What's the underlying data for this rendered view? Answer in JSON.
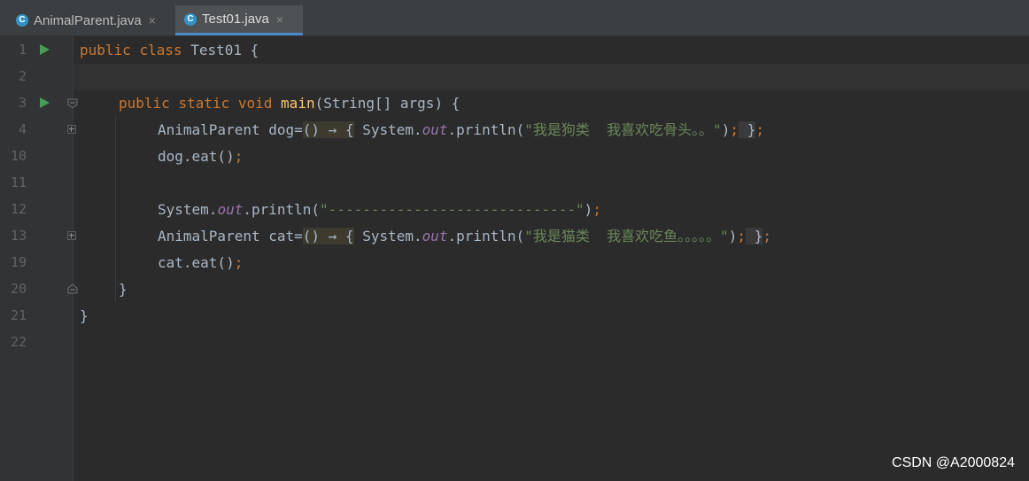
{
  "tabs": [
    {
      "label": "AnimalParent.java",
      "icon": "java-class-icon",
      "active": false,
      "close": "×"
    },
    {
      "label": "Test01.java",
      "icon": "java-class-icon",
      "active": true,
      "close": "×"
    }
  ],
  "gutter": {
    "line_numbers": [
      "1",
      "2",
      "3",
      "4",
      "10",
      "11",
      "12",
      "13",
      "19",
      "20",
      "21",
      "22"
    ]
  },
  "code": {
    "l1": {
      "kw1": "public",
      "kw2": "class",
      "name": "Test01 {"
    },
    "l3": {
      "kw1": "public",
      "kw2": "static",
      "kw3": "void",
      "fn": "main",
      "rest": "(String[] args) {"
    },
    "l4": {
      "a": "AnimalParent dog=",
      "lam": "() → {",
      "b": " System.",
      "field": "out",
      "c": ".println(",
      "str": "\"我是狗类  我喜欢吃骨头。。\"",
      "d": ")",
      "semi": ";",
      "e": " }",
      "semi2": ";"
    },
    "l10": {
      "a": "dog.eat()",
      "semi": ";"
    },
    "l12": {
      "a": "System.",
      "field": "out",
      "b": ".println(",
      "str": "\"-----------------------------\"",
      "c": ")",
      "semi": ";"
    },
    "l13": {
      "a": "AnimalParent cat=",
      "lam": "() → {",
      "b": " System.",
      "field": "out",
      "c": ".println(",
      "str": "\"我是猫类  我喜欢吃鱼。。。。。\"",
      "d": ")",
      "semi": ";",
      "e": " }",
      "semi2": ";"
    },
    "l19": {
      "a": "cat.eat()",
      "semi": ";"
    },
    "l20": {
      "a": "}"
    },
    "l21": {
      "a": "}"
    }
  },
  "watermark": "CSDN @A2000824",
  "colors": {
    "keyword": "#cc7832",
    "string": "#6a8759",
    "field": "#9876aa",
    "method": "#ffc66d",
    "text": "#a9b7c6",
    "run": "#499c54",
    "tab_accent": "#4a88c7"
  }
}
